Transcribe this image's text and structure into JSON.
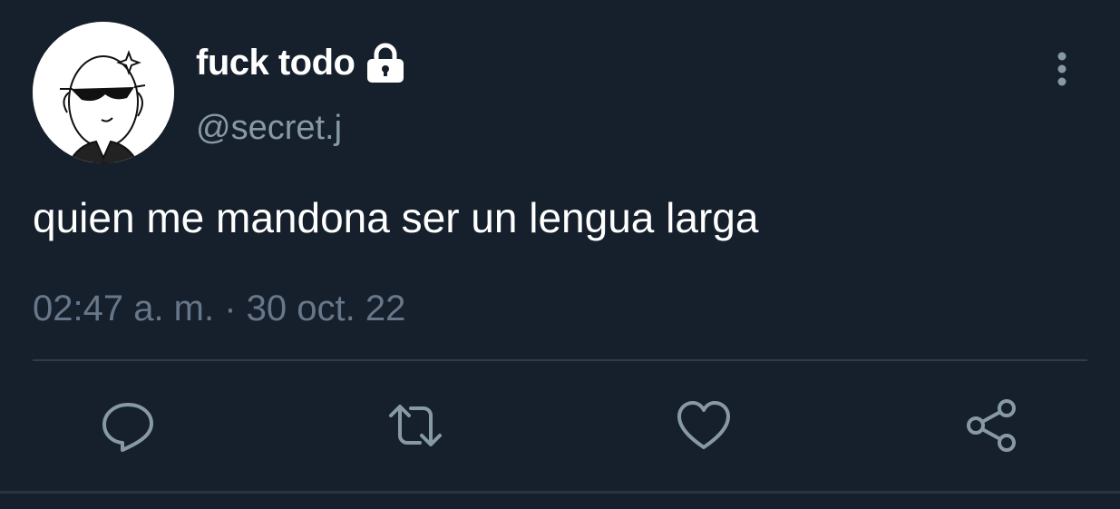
{
  "tweet": {
    "display_name": "fuck todo",
    "handle": "@secret.j",
    "text": "quien me mandona ser un lengua larga",
    "timestamp": "02:47 a. m. · 30 oct. 22",
    "protected_icon": "lock-icon"
  },
  "actions": {
    "reply_icon": "reply-icon",
    "retweet_icon": "retweet-icon",
    "like_icon": "heart-icon",
    "share_icon": "share-icon",
    "more_icon": "more-vertical-icon"
  },
  "colors": {
    "background": "#16202c",
    "text_primary": "#ffffff",
    "text_secondary": "#8899a6",
    "icon": "#8899a6",
    "divider": "#2f3b48"
  }
}
